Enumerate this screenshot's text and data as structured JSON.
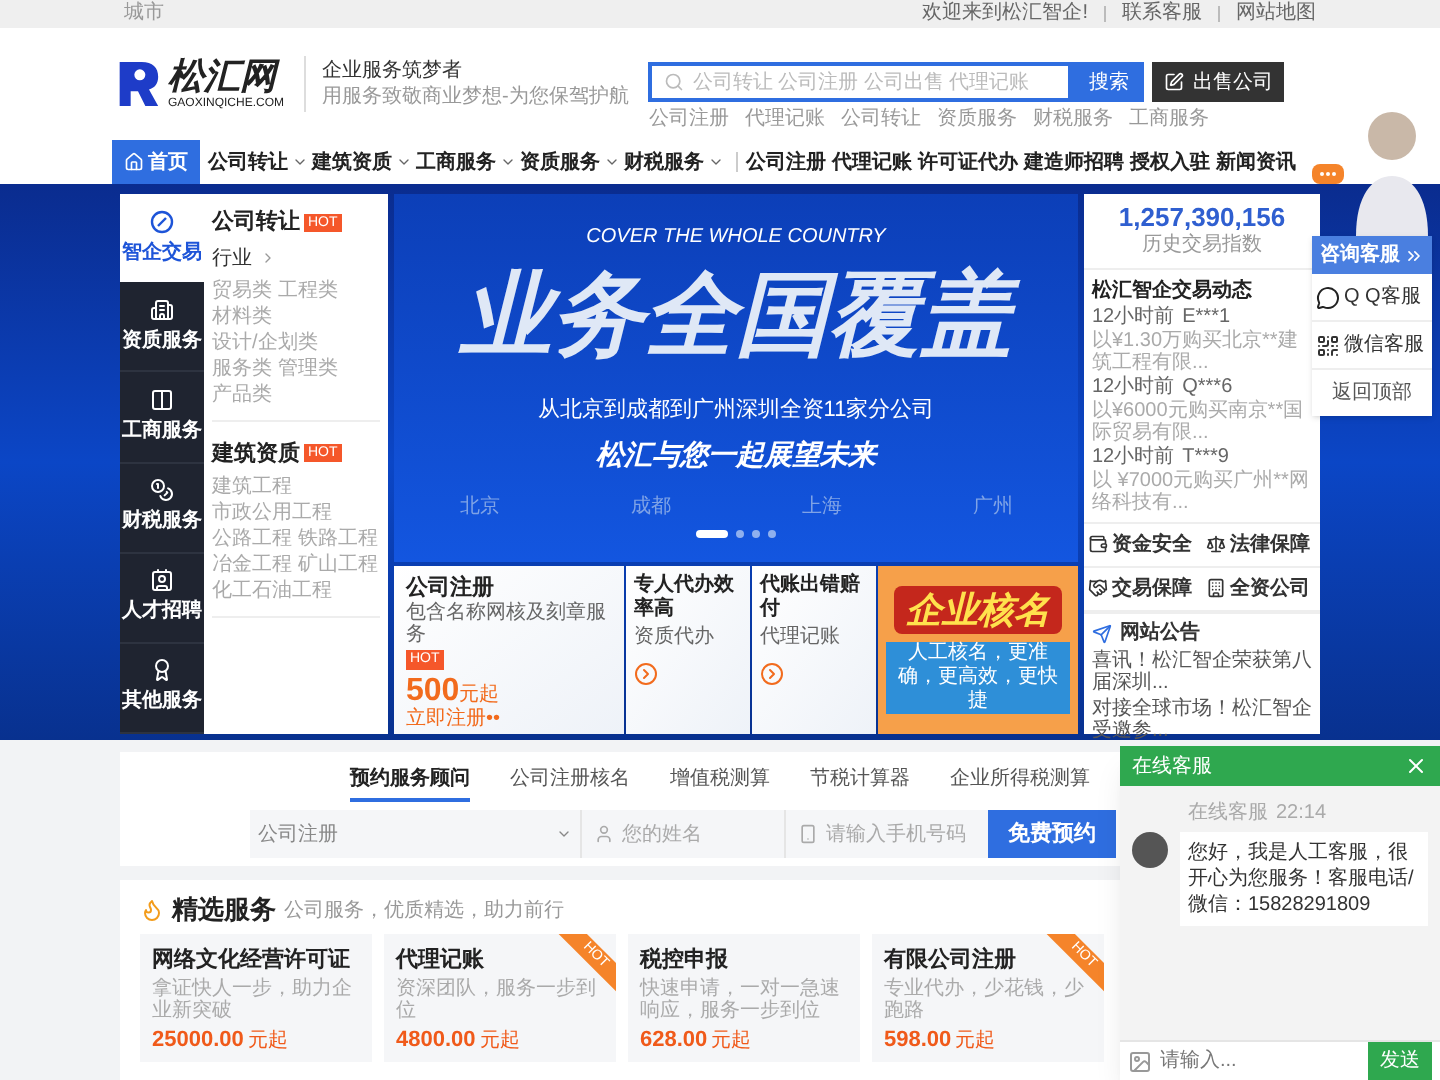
{
  "topbar": {
    "city": "城市",
    "links": [
      "欢迎来到松汇智企!",
      "联系客服",
      "网站地图"
    ]
  },
  "header": {
    "logo": {
      "name": "松汇网",
      "domain": "GAOXINQICHE.COM"
    },
    "slogan": {
      "title": "企业服务筑梦者",
      "subtitle": "用服务致敬商业梦想-为您保驾护航"
    },
    "search": {
      "placeholder": "公司转让 公司注册 公司出售 代理记账",
      "button": "搜索"
    },
    "sell_button": "出售公司",
    "hot_links": [
      "公司注册",
      "代理记账",
      "公司转让",
      "资质服务",
      "财税服务",
      "工商服务"
    ]
  },
  "nav": {
    "items": [
      {
        "label": "首页",
        "selected": true,
        "dropdown": false
      },
      {
        "label": "公司转让",
        "selected": false,
        "dropdown": true
      },
      {
        "label": "建筑资质",
        "selected": false,
        "dropdown": true
      },
      {
        "label": "工商服务",
        "selected": false,
        "dropdown": true
      },
      {
        "label": "资质服务",
        "selected": false,
        "dropdown": true
      },
      {
        "label": "财税服务",
        "selected": false,
        "dropdown": true
      }
    ],
    "links": [
      "公司注册",
      "代理记账",
      "许可证代办",
      "建造师招聘",
      "授权入驻",
      "新闻资讯"
    ]
  },
  "sidebar": {
    "categories": [
      {
        "label": "智企交易",
        "selected": true
      },
      {
        "label": "资质服务",
        "selected": false
      },
      {
        "label": "工商服务",
        "selected": false
      },
      {
        "label": "财税服务",
        "selected": false
      },
      {
        "label": "人才招聘",
        "selected": false
      },
      {
        "label": "其他服务",
        "selected": false
      }
    ]
  },
  "category_panel": {
    "groups": [
      {
        "title": "公司转让",
        "badge": "HOT",
        "filter": "行业",
        "tags": [
          "贸易类",
          "工程类",
          "材料类",
          "设计/企划类",
          "服务类",
          "管理类",
          "产品类"
        ]
      },
      {
        "title": "建筑资质",
        "badge": "HOT",
        "tags": [
          "建筑工程",
          "市政公用工程",
          "公路工程",
          "铁路工程",
          "冶金工程",
          "矿山工程",
          "化工石油工程"
        ]
      }
    ]
  },
  "banner": {
    "tagline": "COVER THE WHOLE COUNTRY",
    "headline": "业务全国覆盖",
    "subline": "从北京到成都到广州深圳全资11家分公司",
    "slogan": "松汇与您一起展望未来",
    "cities": [
      "北京",
      "成都",
      "上海",
      "广州"
    ],
    "dots": [
      {
        "selected": true
      },
      {
        "selected": false
      },
      {
        "selected": false
      },
      {
        "selected": false
      }
    ]
  },
  "promo_cards": [
    {
      "kind": "price",
      "title": "公司注册",
      "desc": "包含名称网核及刻章服务",
      "badge": "HOT",
      "price": "500",
      "unit": "元起",
      "link": "立即注册••"
    },
    {
      "kind": "service",
      "title": "专人代办效率高",
      "desc": "资质代办"
    },
    {
      "kind": "service",
      "title": "代账出错赔付",
      "desc": "代理记账"
    },
    {
      "kind": "ad",
      "title": "企业核名",
      "desc": "人工核名，更准确，更高效，更快捷"
    }
  ],
  "stats": {
    "value": "1,257,390,156",
    "caption": "历史交易指数"
  },
  "activity": {
    "title": "松汇智企交易动态",
    "entries": [
      {
        "time": "12小时前",
        "user": "E***1",
        "text": "以¥1.30万购买北京**建筑工程有限..."
      },
      {
        "time": "12小时前",
        "user": "Q***6",
        "text": "以¥6000元购买南京**国际贸易有限..."
      },
      {
        "time": "12小时前",
        "user": "T***9",
        "text": "以 ¥7000元购买广州**网络科技有..."
      }
    ]
  },
  "guarantees": [
    "资金安全",
    "法律保障",
    "交易保障",
    "全资公司"
  ],
  "notices": {
    "title": "网站公告",
    "items": [
      "喜讯！松汇智企荣获第八届深圳...",
      "对接全球市场！松汇智企受邀参..."
    ]
  },
  "consult": {
    "title": "咨询客服",
    "items": [
      "Q Q客服",
      "微信客服"
    ],
    "back_top": "返回顶部"
  },
  "booking": {
    "tabs": [
      {
        "label": "预约服务顾问",
        "selected": true
      },
      {
        "label": "公司注册核名",
        "selected": false
      },
      {
        "label": "增值税测算",
        "selected": false
      },
      {
        "label": "节税计算器",
        "selected": false
      },
      {
        "label": "企业所得税测算",
        "selected": false
      }
    ],
    "select": "公司注册",
    "name_placeholder": "您的姓名",
    "phone_placeholder": "请输入手机号码",
    "button": "免费预约"
  },
  "featured": {
    "title": "精选服务",
    "subtitle": "公司服务，优质精选，助力前行",
    "cards": [
      {
        "title": "网络文化经营许可证",
        "desc": "拿证快人一步，助力企业新突破",
        "price": "25000.00",
        "unit": "元起"
      },
      {
        "title": "代理记账",
        "desc": "资深团队，服务一步到位",
        "price": "4800.00",
        "unit": "元起",
        "badge": "HOT"
      },
      {
        "title": "税控申报",
        "desc": "快速申请，一对一急速响应，服务一步到位",
        "price": "628.00",
        "unit": "元起"
      },
      {
        "title": "有限公司注册",
        "desc": "专业代办，少花钱，少跑路",
        "price": "598.00",
        "unit": "元起",
        "badge": "HOT"
      }
    ]
  },
  "chat": {
    "title": "在线客服",
    "sender": "在线客服",
    "time": "22:14",
    "message": "您好，我是人工客服，很开心为您服务！客服电话/微信：15828291809",
    "input_placeholder": "请输入...",
    "send": "发送"
  }
}
